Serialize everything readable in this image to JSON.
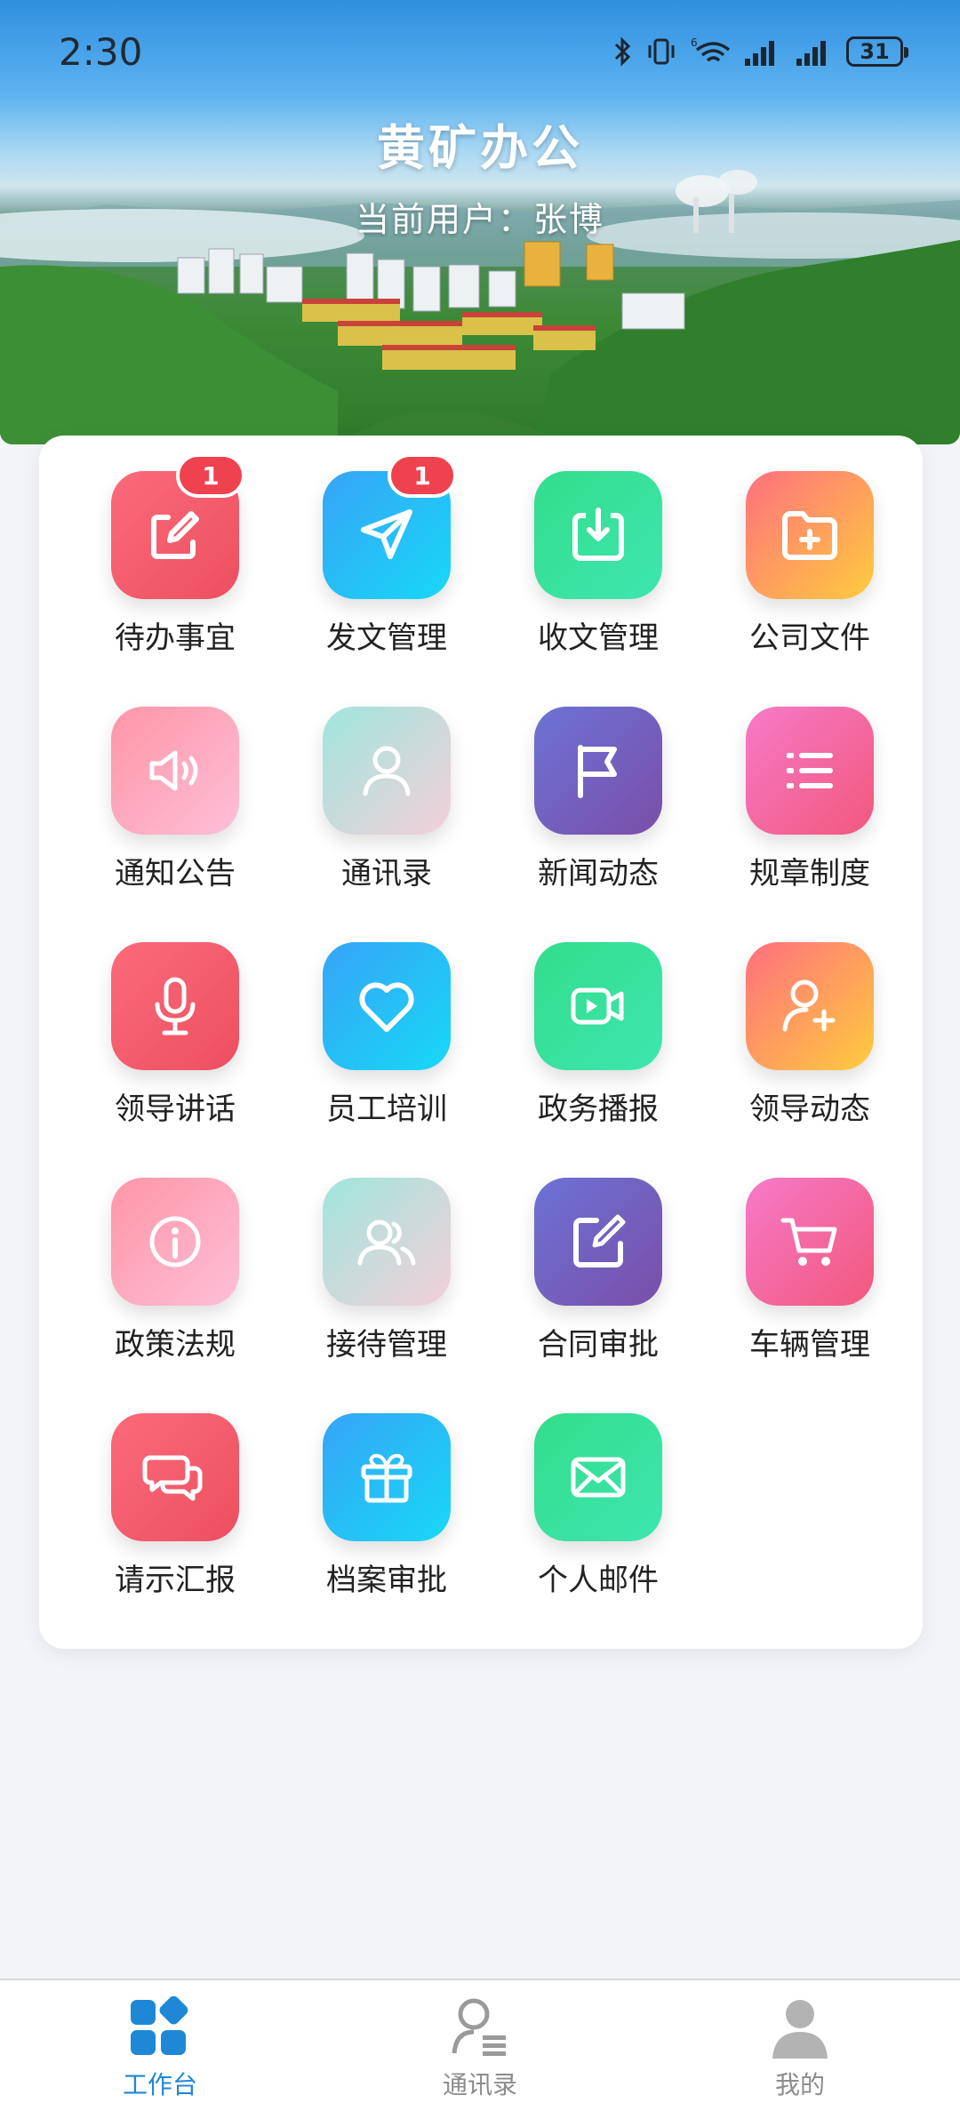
{
  "status_bar": {
    "time": "2:30",
    "battery": "31",
    "network_label": "6"
  },
  "header": {
    "title": "黄矿办公",
    "user_line": "当前用户：张博"
  },
  "grid": {
    "items": [
      {
        "label": "待办事宜",
        "icon": "edit-icon",
        "style": "red",
        "badge": "1"
      },
      {
        "label": "发文管理",
        "icon": "send-icon",
        "style": "blue",
        "badge": "1"
      },
      {
        "label": "收文管理",
        "icon": "download-icon",
        "style": "green"
      },
      {
        "label": "公司文件",
        "icon": "folder-add-icon",
        "style": "orange"
      },
      {
        "label": "通知公告",
        "icon": "speaker-icon",
        "style": "pink"
      },
      {
        "label": "通讯录",
        "icon": "person-icon",
        "style": "mint"
      },
      {
        "label": "新闻动态",
        "icon": "flag-icon",
        "style": "purple"
      },
      {
        "label": "规章制度",
        "icon": "list-icon",
        "style": "magenta"
      },
      {
        "label": "领导讲话",
        "icon": "microphone-icon",
        "style": "red"
      },
      {
        "label": "员工培训",
        "icon": "heart-icon",
        "style": "blue"
      },
      {
        "label": "政务播报",
        "icon": "video-icon",
        "style": "green"
      },
      {
        "label": "领导动态",
        "icon": "person-add-icon",
        "style": "orange"
      },
      {
        "label": "政策法规",
        "icon": "info-icon",
        "style": "pink"
      },
      {
        "label": "接待管理",
        "icon": "people-icon",
        "style": "mint"
      },
      {
        "label": "合同审批",
        "icon": "edit-square-icon",
        "style": "purple"
      },
      {
        "label": "车辆管理",
        "icon": "cart-icon",
        "style": "magenta"
      },
      {
        "label": "请示汇报",
        "icon": "chat-icon",
        "style": "red"
      },
      {
        "label": "档案审批",
        "icon": "gift-icon",
        "style": "blue"
      },
      {
        "label": "个人邮件",
        "icon": "mail-icon",
        "style": "green"
      }
    ]
  },
  "bottom_nav": {
    "items": [
      {
        "label": "工作台",
        "icon": "dashboard-icon",
        "active": true
      },
      {
        "label": "通讯录",
        "icon": "contacts-icon",
        "active": false
      },
      {
        "label": "我的",
        "icon": "user-icon",
        "active": false
      }
    ]
  },
  "colors": {
    "accent": "#1e88d6",
    "badge": "#f0414e",
    "inactive_nav": "#8c8c8c"
  }
}
